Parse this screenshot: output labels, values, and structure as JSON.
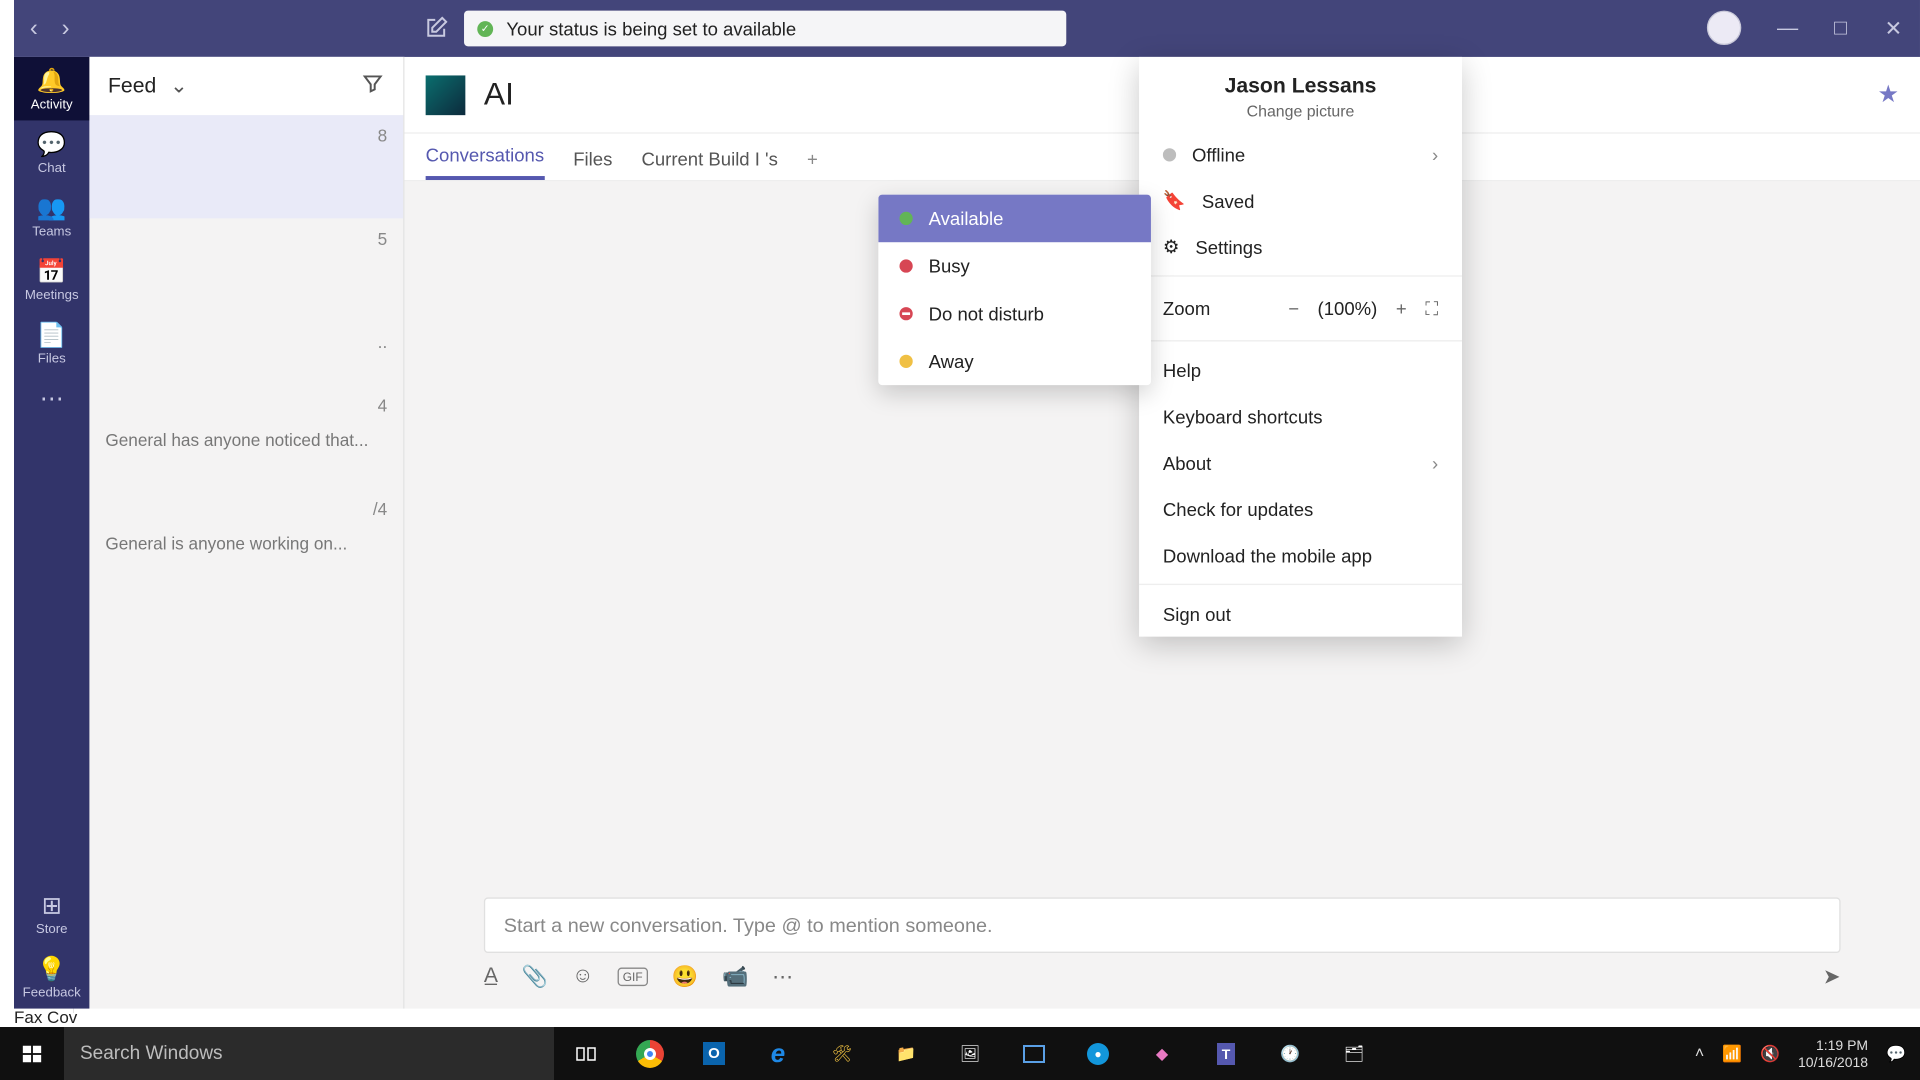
{
  "titlebar": {
    "toast": "Your status is being set to available"
  },
  "rail": {
    "activity": "Activity",
    "chat": "Chat",
    "teams": "Teams",
    "meetings": "Meetings",
    "files": "Files",
    "store": "Store",
    "feedback": "Feedback"
  },
  "feed": {
    "header": "Feed",
    "items": [
      {
        "right": "8",
        "snippet": ""
      },
      {
        "right": "5",
        "snippet": ""
      },
      {
        "right": "..",
        "snippet": ""
      },
      {
        "right": "4",
        "snippet": "General has anyone noticed that..."
      },
      {
        "right": "/4",
        "snippet": "General is anyone working on..."
      }
    ]
  },
  "mainHeader": {
    "teamName": "AI"
  },
  "tabs": {
    "conversations": "Conversations",
    "files": "Files",
    "currentBuild": "Current Build I            's",
    "add": "+"
  },
  "composer": {
    "placeholder": "Start a new conversation. Type @ to mention someone."
  },
  "statusMenu": {
    "available": "Available",
    "busy": "Busy",
    "dnd": "Do not disturb",
    "away": "Away"
  },
  "profileMenu": {
    "name": "Jason Lessans",
    "changePicture": "Change picture",
    "status": "Offline",
    "saved": "Saved",
    "settings": "Settings",
    "zoomLabel": "Zoom",
    "zoomValue": "(100%)",
    "help": "Help",
    "shortcuts": "Keyboard shortcuts",
    "about": "About",
    "updates": "Check for updates",
    "download": "Download the mobile app",
    "signout": "Sign out"
  },
  "browserStrip": {
    "edgeLabel": "E",
    "faxLabel": "Fax Cov"
  },
  "taskbar": {
    "search": "Search Windows",
    "time": "1:19 PM",
    "date": "10/16/2018"
  }
}
